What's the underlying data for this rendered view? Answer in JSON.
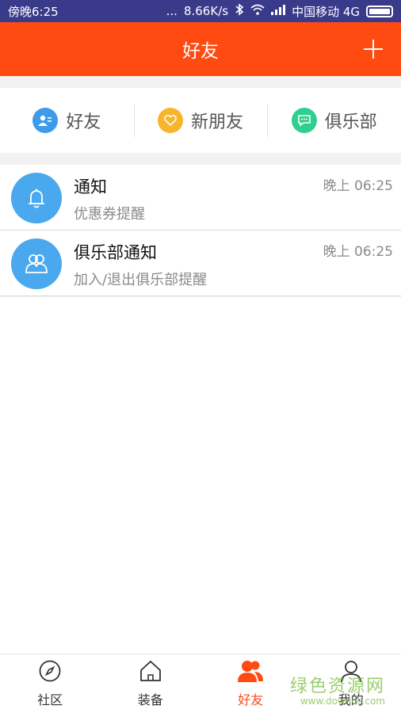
{
  "status_bar": {
    "time": "傍晚6:25",
    "dots": "...",
    "speed": "8.66K/s",
    "carrier": "中国移动 4G",
    "bg": "#3a3a8a"
  },
  "header": {
    "title": "好友",
    "add_icon": "plus-icon",
    "bg": "#ff4a12"
  },
  "categories": [
    {
      "label": "好友",
      "icon": "contact-card-icon",
      "color": "#3d9bea"
    },
    {
      "label": "新朋友",
      "icon": "heart-icon",
      "color": "#f7b42c"
    },
    {
      "label": "俱乐部",
      "icon": "chat-bubble-icon",
      "color": "#2fcf8f"
    }
  ],
  "messages": [
    {
      "title": "通知",
      "subtitle": "优惠券提醒",
      "time": "晚上 06:25",
      "icon": "bell-icon"
    },
    {
      "title": "俱乐部通知",
      "subtitle": "加入/退出俱乐部提醒",
      "time": "晚上 06:25",
      "icon": "group-icon"
    }
  ],
  "bottom_nav": [
    {
      "label": "社区",
      "icon": "compass-icon",
      "active": false
    },
    {
      "label": "装备",
      "icon": "home-icon",
      "active": false
    },
    {
      "label": "好友",
      "icon": "friends-icon",
      "active": true
    },
    {
      "label": "我的",
      "icon": "user-icon",
      "active": false
    }
  ],
  "accent": "#ff4a12",
  "watermark": {
    "main": "绿色资源网",
    "sub": "www.downcc.com"
  }
}
